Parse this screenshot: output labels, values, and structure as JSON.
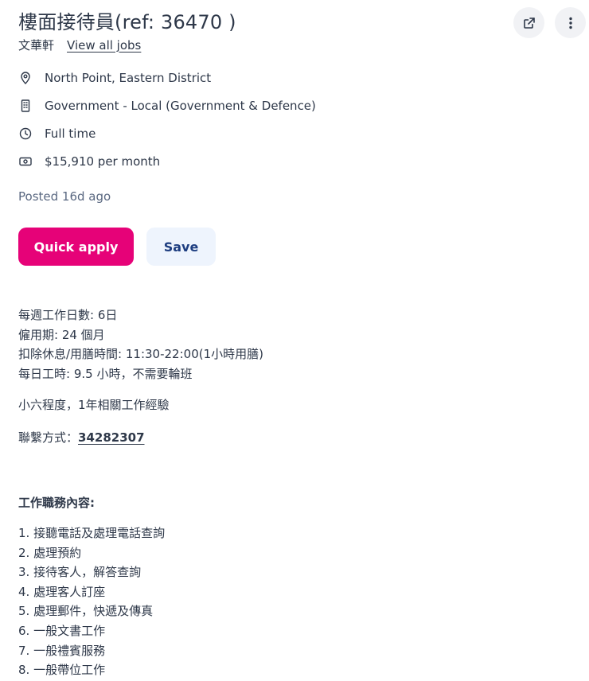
{
  "job": {
    "title": "樓面接待員(ref: 36470 )",
    "company": "文華軒",
    "view_all_jobs": "View all jobs",
    "location": "North Point, Eastern District",
    "category": "Government - Local (Government & Defence)",
    "work_type": "Full time",
    "salary": "$15,910 per month",
    "posted": "Posted 16d ago"
  },
  "actions": {
    "quick_apply": "Quick apply",
    "save": "Save"
  },
  "icons": {
    "share": "share-external-icon",
    "more": "more-vertical-icon",
    "location": "location-pin-icon",
    "category": "building-icon",
    "work_type": "clock-icon",
    "salary": "money-icon"
  },
  "description": {
    "lines": [
      "每週工作日數: 6日",
      "僱用期: 24 個月",
      "扣除休息/用膳時間: 11:30-22:00(1小時用膳)",
      "每日工時: 9.5 小時，不需要輪班"
    ],
    "requirement": "小六程度，1年相關工作經驗",
    "contact_label": "聯繫方式：",
    "contact_phone": "34282307"
  },
  "duties": {
    "heading": "工作職務內容:",
    "items": [
      "1. 接聽電話及處理電話查詢",
      "2. 處理預約",
      "3. 接待客人，解答查詢",
      "4. 處理客人訂座",
      "5. 處理郵件，快遞及傳真",
      "6. 一般文書工作",
      "7. 一般禮賓服務",
      "8. 一般帶位工作"
    ]
  },
  "colors": {
    "brand_pink": "#e60278",
    "save_bg": "#eef4fd",
    "save_text": "#1d3d80",
    "text": "#2e3849",
    "muted": "#5a6881"
  }
}
